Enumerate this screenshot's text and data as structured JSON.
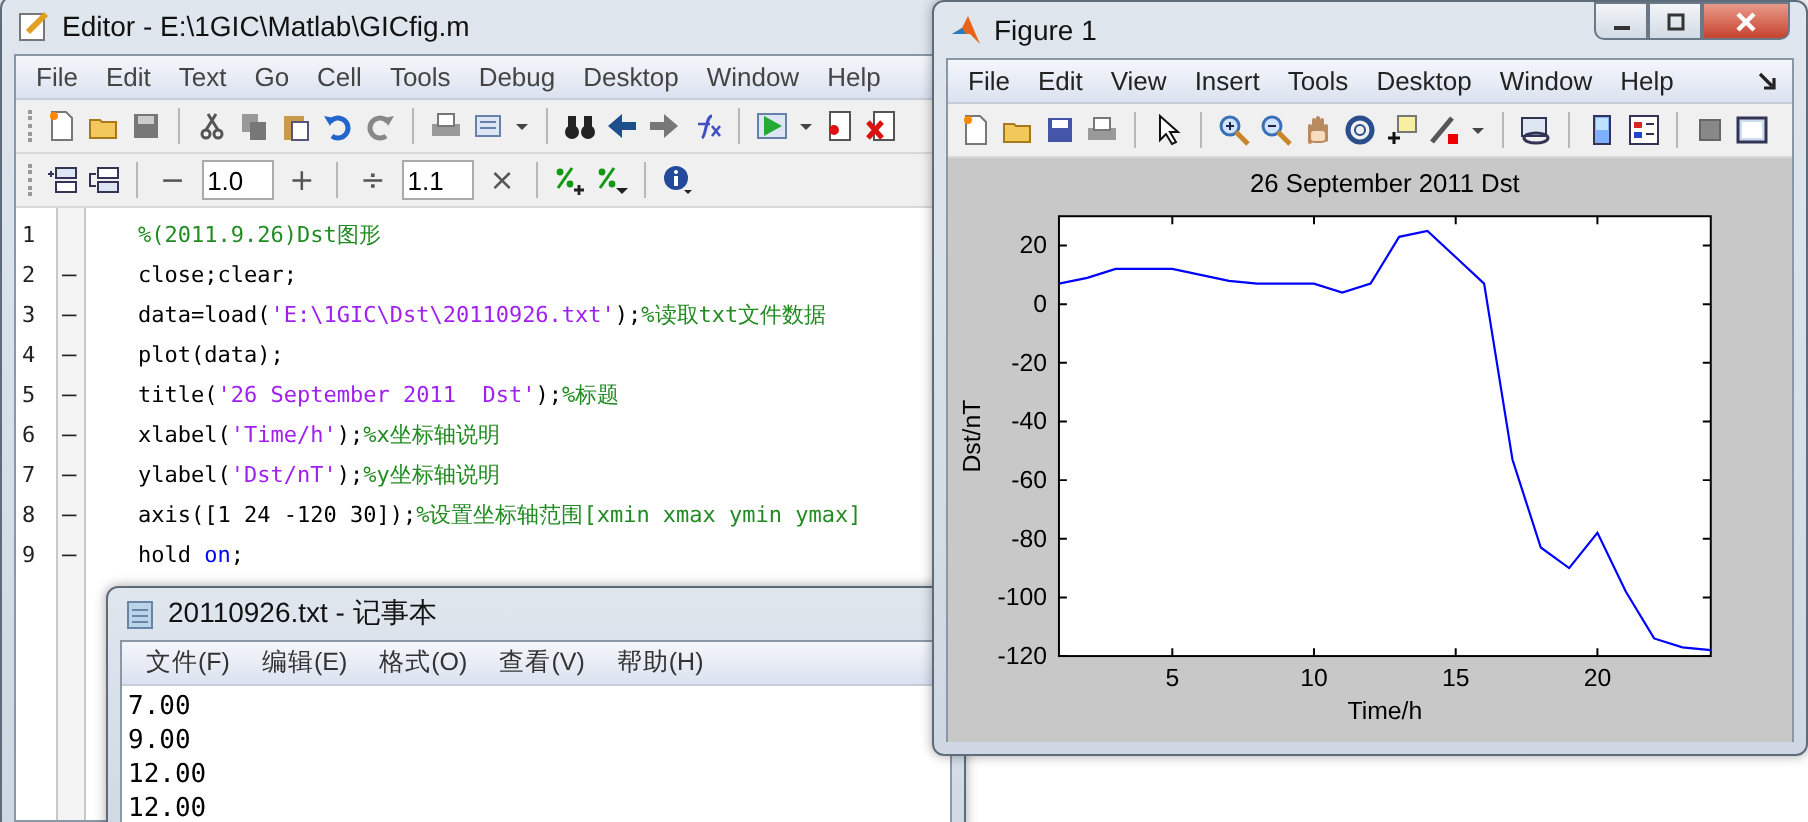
{
  "editor": {
    "title": "Editor - E:\\1GIC\\Matlab\\GICfig.m",
    "menu": [
      "File",
      "Edit",
      "Text",
      "Go",
      "Cell",
      "Tools",
      "Debug",
      "Desktop",
      "Window",
      "Help"
    ],
    "cell_toolbar": {
      "decrement": "−",
      "step_value": "1.0",
      "increment": "+",
      "divide": "÷",
      "factor_value": "1.1",
      "multiply": "×"
    },
    "code_lines": [
      {
        "number": "1",
        "segments": [
          {
            "kind": "comment",
            "text": "%(2011.9.26)Dst图形"
          }
        ]
      },
      {
        "number": "2",
        "marker": "–",
        "segments": [
          {
            "kind": "code",
            "text": "close;clear;"
          }
        ]
      },
      {
        "number": "3",
        "marker": "–",
        "segments": [
          {
            "kind": "code",
            "text": "data=load("
          },
          {
            "kind": "string",
            "text": "'E:\\1GIC\\Dst\\20110926.txt'"
          },
          {
            "kind": "code",
            "text": ");"
          },
          {
            "kind": "comment",
            "text": "%读取txt文件数据"
          }
        ]
      },
      {
        "number": "4",
        "marker": "–",
        "segments": [
          {
            "kind": "code",
            "text": "plot(data);"
          }
        ]
      },
      {
        "number": "5",
        "marker": "–",
        "segments": [
          {
            "kind": "code",
            "text": "title("
          },
          {
            "kind": "string",
            "text": "'26 September 2011  Dst'"
          },
          {
            "kind": "code",
            "text": ");"
          },
          {
            "kind": "comment",
            "text": "%标题"
          }
        ]
      },
      {
        "number": "6",
        "marker": "–",
        "segments": [
          {
            "kind": "code",
            "text": "xlabel("
          },
          {
            "kind": "string",
            "text": "'Time/h'"
          },
          {
            "kind": "code",
            "text": ");"
          },
          {
            "kind": "comment",
            "text": "%x坐标轴说明"
          }
        ]
      },
      {
        "number": "7",
        "marker": "–",
        "segments": [
          {
            "kind": "code",
            "text": "ylabel("
          },
          {
            "kind": "string",
            "text": "'Dst/nT'"
          },
          {
            "kind": "code",
            "text": ");"
          },
          {
            "kind": "comment",
            "text": "%y坐标轴说明"
          }
        ]
      },
      {
        "number": "8",
        "marker": "–",
        "segments": [
          {
            "kind": "code",
            "text": "axis([1 24 -120 30]);"
          },
          {
            "kind": "comment",
            "text": "%设置坐标轴范围[xmin xmax ymin ymax]"
          }
        ]
      },
      {
        "number": "9",
        "marker": "–",
        "segments": [
          {
            "kind": "code",
            "text": "hold "
          },
          {
            "kind": "keyword",
            "text": "on"
          },
          {
            "kind": "code",
            "text": ";"
          }
        ]
      }
    ]
  },
  "notepad": {
    "title": "20110926.txt - 记事本",
    "menu": [
      "文件(F)",
      "编辑(E)",
      "格式(O)",
      "查看(V)",
      "帮助(H)"
    ],
    "lines": [
      "7.00",
      "9.00",
      "12.00",
      "12.00"
    ]
  },
  "figure": {
    "title": "Figure 1",
    "menu": [
      "File",
      "Edit",
      "View",
      "Insert",
      "Tools",
      "Desktop",
      "Window",
      "Help"
    ],
    "chart_data": {
      "type": "line",
      "title": "26 September 2011  Dst",
      "xlabel": "Time/h",
      "ylabel": "Dst/nT",
      "x": [
        1,
        2,
        3,
        4,
        5,
        6,
        7,
        8,
        9,
        10,
        11,
        12,
        13,
        14,
        15,
        16,
        17,
        18,
        19,
        20,
        21,
        22,
        23,
        24
      ],
      "series": [
        {
          "color": "#0000ff",
          "values": [
            7,
            9,
            12,
            12,
            12,
            10,
            8,
            7,
            7,
            7,
            4,
            7,
            23,
            25,
            16,
            7,
            -53,
            -83,
            -90,
            -78,
            -98,
            -114,
            -117,
            -118
          ]
        }
      ],
      "xlim": [
        1,
        24
      ],
      "ylim": [
        -120,
        30
      ],
      "xticks": [
        5,
        10,
        15,
        20
      ],
      "yticks": [
        -120,
        -100,
        -80,
        -60,
        -40,
        -20,
        0,
        20
      ]
    }
  }
}
